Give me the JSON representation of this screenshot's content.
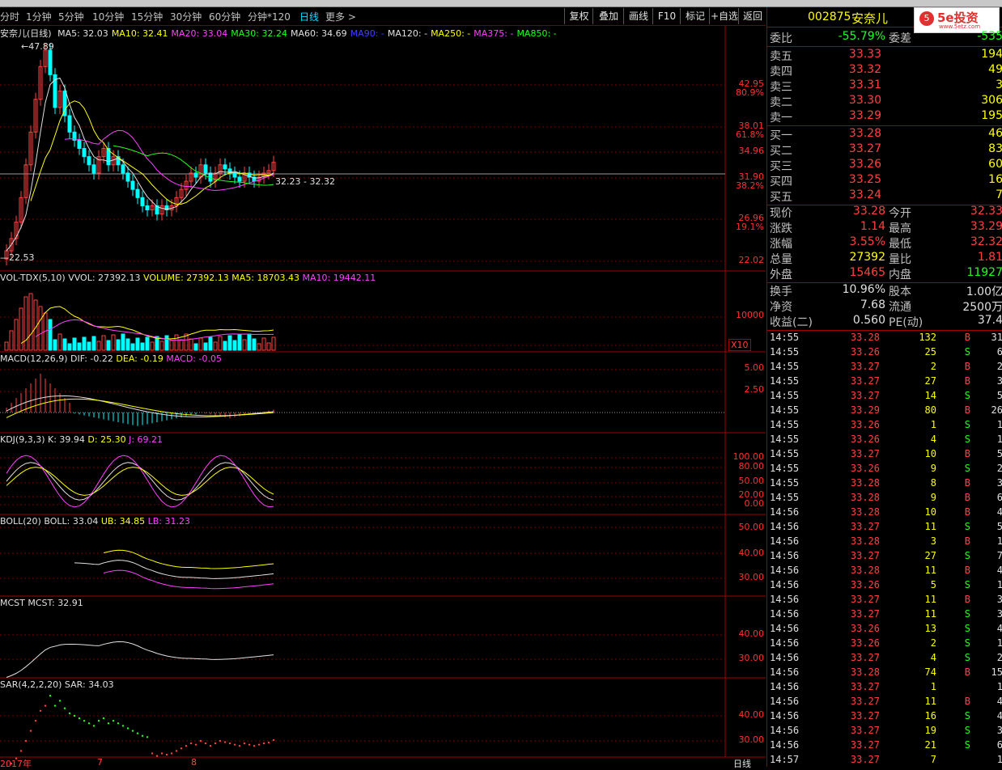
{
  "periods": [
    "分时",
    "1分钟",
    "5分钟",
    "10分钟",
    "15分钟",
    "30分钟",
    "60分钟",
    "分钟*120",
    "日线",
    "更多 >"
  ],
  "active_period": "日线",
  "toolbar": [
    "复权",
    "叠加",
    "画线",
    "F10",
    "标记",
    "+自选",
    "返回"
  ],
  "stock": {
    "code": "002875",
    "name": "安奈儿"
  },
  "logo": {
    "text": "5e投资",
    "url": "www.5etz.com"
  },
  "main_panel": {
    "title": "安奈儿(日线)",
    "ma": [
      {
        "label": "MA5: 32.03",
        "color": "#e0e0e0"
      },
      {
        "label": "MA10: 32.41",
        "color": "#ffff00"
      },
      {
        "label": "MA20: 33.04",
        "color": "#ff40ff"
      },
      {
        "label": "MA30: 32.24",
        "color": "#20ff20"
      },
      {
        "label": "MA60: 34.69",
        "color": "#e0e0e0"
      },
      {
        "label": "MA90: -",
        "color": "#4040ff"
      },
      {
        "label": "MA120: -",
        "color": "#e0e0e0"
      },
      {
        "label": "MA250: -",
        "color": "#ffff00"
      },
      {
        "label": "MA375: -",
        "color": "#ff40ff"
      },
      {
        "label": "MA850: -",
        "color": "#20ff20"
      }
    ],
    "axis": [
      {
        "v": "42.95",
        "pct": "80.9%"
      },
      {
        "v": "38.01",
        "pct": "61.8%"
      },
      {
        "v": "34.96",
        "pct": ""
      },
      {
        "v": "31.90",
        "pct": "38.2%"
      },
      {
        "v": "26.96",
        "pct": "19.1%"
      },
      {
        "v": "22.02",
        "pct": ""
      }
    ],
    "high_label": "47.89",
    "low_label": "22.53",
    "range_label": "32.23 - 32.32"
  },
  "vol_panel": {
    "title": "VOL-TDX(5,10)",
    "vvol": "VVOL: 27392.13",
    "volume": "VOLUME: 27392.13",
    "ma5": "MA5: 18703.43",
    "ma10": "MA10: 19442.11",
    "axis": "10000",
    "unit": "X10"
  },
  "macd_panel": {
    "title": "MACD(12,26,9)",
    "dif": "DIF: -0.22",
    "dea": "DEA: -0.19",
    "macd": "MACD: -0.05",
    "axis": [
      "5.00",
      "2.50"
    ]
  },
  "kdj_panel": {
    "title": "KDJ(9,3,3)",
    "k": "K: 39.94",
    "d": "D: 25.30",
    "j": "J: 69.21",
    "axis": [
      "100.00",
      "80.00",
      "50.00",
      "20.00",
      "0.00"
    ]
  },
  "boll_panel": {
    "title": "BOLL(20)",
    "boll": "BOLL: 33.04",
    "ub": "UB: 34.85",
    "lb": "LB: 31.23",
    "axis": [
      "50.00",
      "40.00",
      "30.00"
    ]
  },
  "mcst_panel": {
    "title": "MCST",
    "mcst": "MCST: 32.91",
    "axis": [
      "40.00",
      "30.00"
    ]
  },
  "sar_panel": {
    "title": "SAR(4,2,2,20)",
    "sar": "SAR: 34.03",
    "axis": [
      "40.00",
      "30.00"
    ]
  },
  "xaxis": {
    "year": "2017年",
    "m1": "7",
    "m2": "8",
    "period": "日线"
  },
  "quote": {
    "weibi": {
      "k": "委比",
      "v": "-55.79%",
      "k2": "委差",
      "v2": "-535"
    },
    "sell": [
      {
        "k": "卖五",
        "p": "33.33",
        "q": "194"
      },
      {
        "k": "卖四",
        "p": "33.32",
        "q": "49"
      },
      {
        "k": "卖三",
        "p": "33.31",
        "q": "3"
      },
      {
        "k": "卖二",
        "p": "33.30",
        "q": "306"
      },
      {
        "k": "卖一",
        "p": "33.29",
        "q": "195"
      }
    ],
    "buy": [
      {
        "k": "买一",
        "p": "33.28",
        "q": "46"
      },
      {
        "k": "买二",
        "p": "33.27",
        "q": "83"
      },
      {
        "k": "买三",
        "p": "33.26",
        "q": "60"
      },
      {
        "k": "买四",
        "p": "33.25",
        "q": "16"
      },
      {
        "k": "买五",
        "p": "33.24",
        "q": "7"
      }
    ],
    "stats": [
      {
        "k": "现价",
        "v": "33.28",
        "vc": "red",
        "k2": "今开",
        "v2": "32.33",
        "v2c": "red"
      },
      {
        "k": "涨跌",
        "v": "1.14",
        "vc": "red",
        "k2": "最高",
        "v2": "33.29",
        "v2c": "red"
      },
      {
        "k": "涨幅",
        "v": "3.55%",
        "vc": "red",
        "k2": "最低",
        "v2": "32.32",
        "v2c": "red"
      },
      {
        "k": "总量",
        "v": "27392",
        "vc": "yel",
        "k2": "量比",
        "v2": "1.81",
        "v2c": "red"
      },
      {
        "k": "外盘",
        "v": "15465",
        "vc": "red",
        "k2": "内盘",
        "v2": "11927",
        "v2c": "grn"
      }
    ],
    "stats2": [
      {
        "k": "换手",
        "v": "10.96%",
        "k2": "股本",
        "v2": "1.00亿"
      },
      {
        "k": "净资",
        "v": "7.68",
        "k2": "流通",
        "v2": "2500万"
      },
      {
        "k": "收益(二)",
        "v": "0.560",
        "k2": "PE(动)",
        "v2": "37.4"
      }
    ]
  },
  "ticks": [
    {
      "t": "14:55",
      "p": "33.28",
      "q": "132",
      "s": "B",
      "n": "31"
    },
    {
      "t": "14:55",
      "p": "33.26",
      "q": "25",
      "s": "S",
      "n": "6"
    },
    {
      "t": "14:55",
      "p": "33.27",
      "q": "2",
      "s": "B",
      "n": "2"
    },
    {
      "t": "14:55",
      "p": "33.27",
      "q": "27",
      "s": "B",
      "n": "3"
    },
    {
      "t": "14:55",
      "p": "33.27",
      "q": "14",
      "s": "S",
      "n": "5"
    },
    {
      "t": "14:55",
      "p": "33.29",
      "q": "80",
      "s": "B",
      "n": "26"
    },
    {
      "t": "14:55",
      "p": "33.26",
      "q": "1",
      "s": "S",
      "n": "1"
    },
    {
      "t": "14:55",
      "p": "33.26",
      "q": "4",
      "s": "S",
      "n": "1"
    },
    {
      "t": "14:55",
      "p": "33.27",
      "q": "10",
      "s": "B",
      "n": "5"
    },
    {
      "t": "14:55",
      "p": "33.26",
      "q": "9",
      "s": "S",
      "n": "2"
    },
    {
      "t": "14:55",
      "p": "33.28",
      "q": "8",
      "s": "B",
      "n": "3"
    },
    {
      "t": "14:55",
      "p": "33.28",
      "q": "9",
      "s": "B",
      "n": "6"
    },
    {
      "t": "14:56",
      "p": "33.28",
      "q": "10",
      "s": "B",
      "n": "4"
    },
    {
      "t": "14:56",
      "p": "33.27",
      "q": "11",
      "s": "S",
      "n": "5"
    },
    {
      "t": "14:56",
      "p": "33.28",
      "q": "3",
      "s": "B",
      "n": "1"
    },
    {
      "t": "14:56",
      "p": "33.27",
      "q": "27",
      "s": "S",
      "n": "7"
    },
    {
      "t": "14:56",
      "p": "33.28",
      "q": "11",
      "s": "B",
      "n": "4"
    },
    {
      "t": "14:56",
      "p": "33.26",
      "q": "5",
      "s": "S",
      "n": "1"
    },
    {
      "t": "14:56",
      "p": "33.27",
      "q": "11",
      "s": "B",
      "n": "3"
    },
    {
      "t": "14:56",
      "p": "33.27",
      "q": "11",
      "s": "S",
      "n": "3"
    },
    {
      "t": "14:56",
      "p": "33.26",
      "q": "13",
      "s": "S",
      "n": "4"
    },
    {
      "t": "14:56",
      "p": "33.26",
      "q": "2",
      "s": "S",
      "n": "1"
    },
    {
      "t": "14:56",
      "p": "33.27",
      "q": "4",
      "s": "S",
      "n": "2"
    },
    {
      "t": "14:56",
      "p": "33.28",
      "q": "74",
      "s": "B",
      "n": "15"
    },
    {
      "t": "14:56",
      "p": "33.27",
      "q": "1",
      "s": "",
      "n": "1"
    },
    {
      "t": "14:56",
      "p": "33.27",
      "q": "11",
      "s": "B",
      "n": "4"
    },
    {
      "t": "14:56",
      "p": "33.27",
      "q": "16",
      "s": "S",
      "n": "4"
    },
    {
      "t": "14:56",
      "p": "33.27",
      "q": "19",
      "s": "S",
      "n": "3"
    },
    {
      "t": "14:56",
      "p": "33.27",
      "q": "21",
      "s": "S",
      "n": "6"
    },
    {
      "t": "14:57",
      "p": "33.27",
      "q": "7",
      "s": "",
      "n": "1"
    }
  ]
}
